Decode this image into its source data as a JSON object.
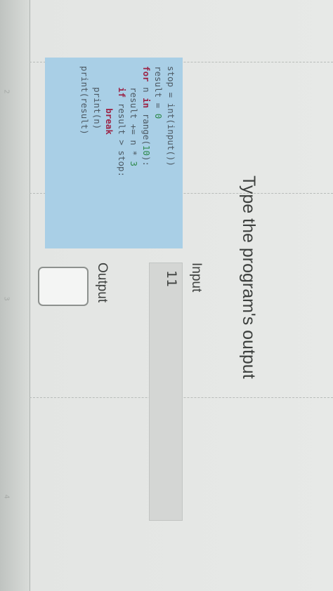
{
  "prompt": {
    "title": "Type the program's output"
  },
  "code": {
    "lines": [
      "stop = int(input())",
      "result = 0",
      "for n in range(10):",
      "    result += n * 3",
      "    if result > stop:",
      "        break",
      "    print(n)",
      "print(result)"
    ]
  },
  "io": {
    "input_label": "Input",
    "input_value": "11",
    "output_label": "Output",
    "output_value": ""
  },
  "page": {
    "margin_marks": [
      "2",
      "3",
      "4"
    ]
  }
}
